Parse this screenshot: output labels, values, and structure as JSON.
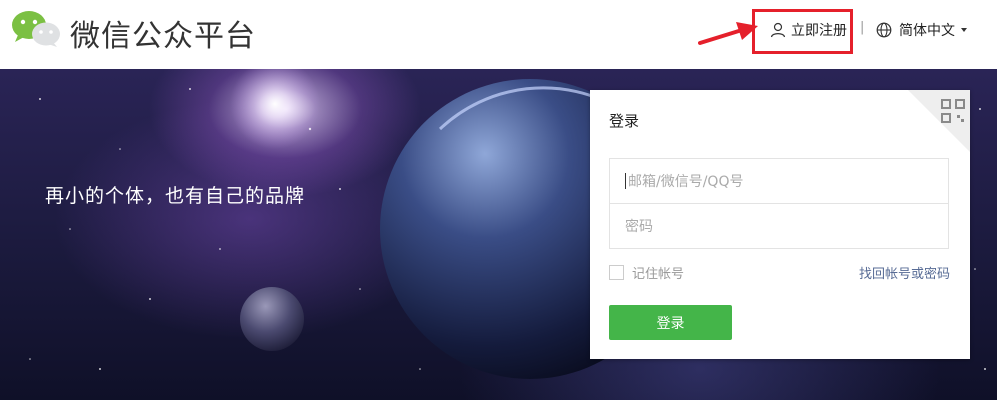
{
  "header": {
    "brand": "微信公众平台",
    "register_label": "立即注册",
    "separator": "|",
    "language_label": "简体中文",
    "icons": [
      "wechat-logo-icon",
      "user-icon",
      "globe-icon",
      "caret-down-icon"
    ],
    "highlight_color": "#e5202b"
  },
  "hero": {
    "slogan": "再小的个体，也有自己的品牌"
  },
  "login": {
    "title": "登录",
    "account_placeholder": "邮箱/微信号/QQ号",
    "password_placeholder": "密码",
    "remember_label": "记住帐号",
    "forgot_label": "找回帐号或密码",
    "submit_label": "登录",
    "qr_icon": "qr-code-icon",
    "accent_color": "#44b549",
    "link_color": "#576b95"
  }
}
